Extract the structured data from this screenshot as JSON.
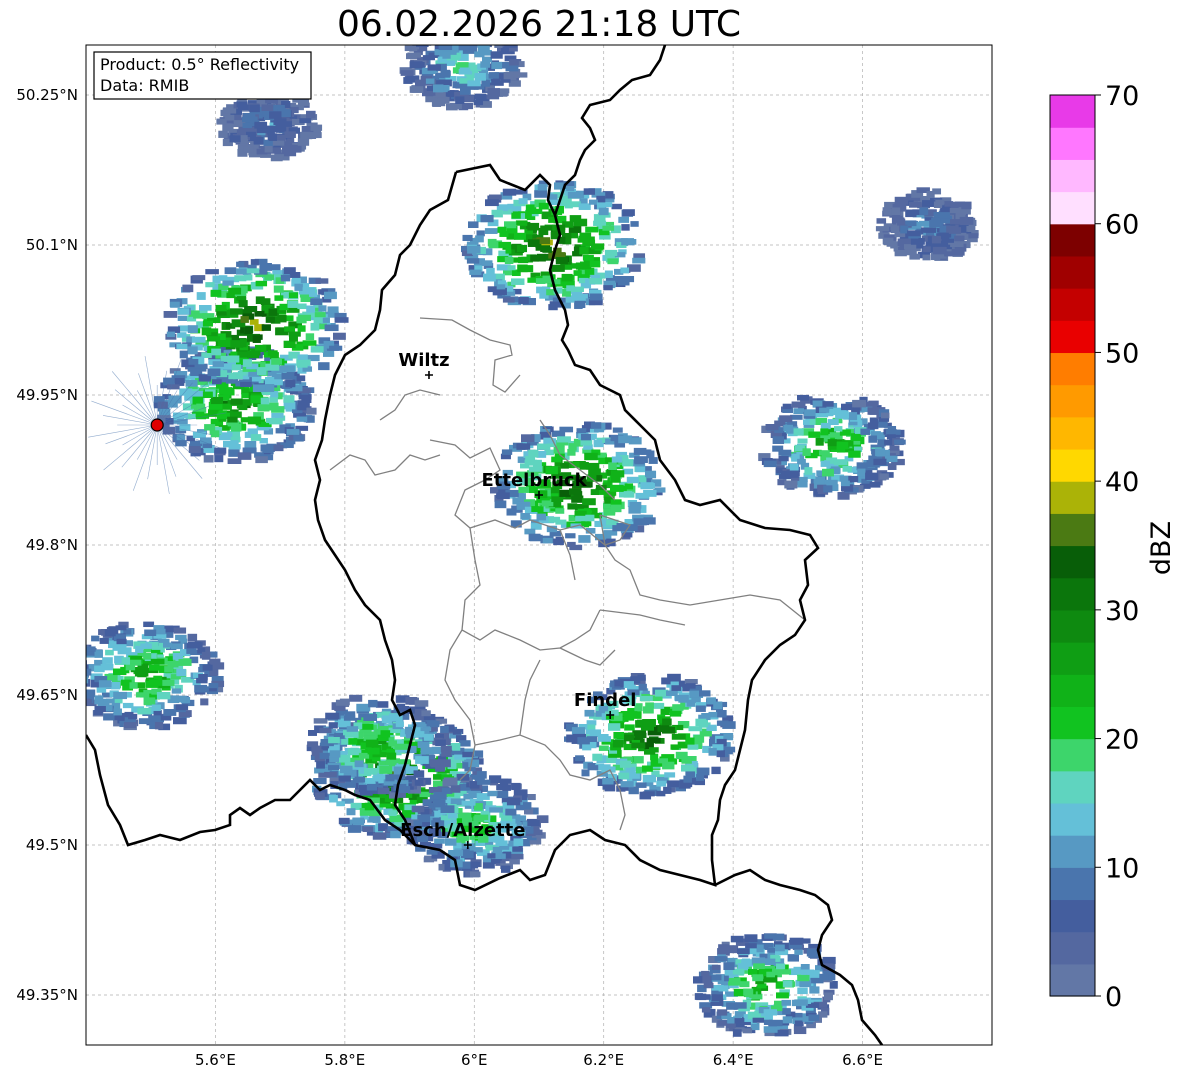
{
  "title": "06.02.2026 21:18 UTC",
  "info_box": {
    "product": "Product: 0.5° Reflectivity",
    "source": "Data: RMIB"
  },
  "axes": {
    "lon_range": [
      5.4,
      6.8
    ],
    "lat_range": [
      49.3,
      50.3
    ],
    "lon_ticks": [
      "5.6°E",
      "5.8°E",
      "6°E",
      "6.2°E",
      "6.4°E",
      "6.6°E"
    ],
    "lat_ticks": [
      "50.25°N",
      "50.1°N",
      "49.95°N",
      "49.8°N",
      "49.65°N",
      "49.5°N",
      "49.35°N"
    ],
    "grid": true
  },
  "cities": [
    {
      "name": "Wiltz",
      "lon": 5.93,
      "lat": 49.97
    },
    {
      "name": "Ettelbruck",
      "lon": 6.1,
      "lat": 49.85
    },
    {
      "name": "Findel",
      "lon": 6.21,
      "lat": 49.63
    },
    {
      "name": "Esch/Alzette",
      "lon": 5.99,
      "lat": 49.5
    }
  ],
  "radar_site": {
    "lon": 5.51,
    "lat": 49.92,
    "color": "#e00000"
  },
  "colorbar": {
    "label": "dBZ",
    "range": [
      0,
      70
    ],
    "tick_labels": [
      "0",
      "10",
      "20",
      "30",
      "40",
      "50",
      "60",
      "70"
    ],
    "colors": [
      "#6277a6",
      "#5468a0",
      "#445e9e",
      "#4a75ad",
      "#5799c3",
      "#64c0d8",
      "#5fd4bf",
      "#3dd56b",
      "#11c320",
      "#10b218",
      "#0f9e14",
      "#0e8a10",
      "#0b760c",
      "#085e08",
      "#4b7a13",
      "#abb307",
      "#ffd800",
      "#ffb700",
      "#ff9a00",
      "#ff7d00",
      "#e90000",
      "#c40000",
      "#a00000",
      "#7d0000",
      "#ffdfff",
      "#ffb8ff",
      "#ff77ff",
      "#e83ae8"
    ]
  },
  "chart_data": {
    "type": "heatmap",
    "title": "06.02.2026 21:18 UTC",
    "value_label": "dBZ",
    "value_range": [
      0,
      70
    ],
    "echo_cells": [
      {
        "lon": 5.49,
        "lat": 49.67,
        "max_dbz": 32
      },
      {
        "lon": 5.63,
        "lat": 49.94,
        "max_dbz": 35
      },
      {
        "lon": 5.66,
        "lat": 50.02,
        "max_dbz": 42
      },
      {
        "lon": 5.88,
        "lat": 49.57,
        "max_dbz": 40
      },
      {
        "lon": 5.85,
        "lat": 49.6,
        "max_dbz": 30
      },
      {
        "lon": 6.0,
        "lat": 49.52,
        "max_dbz": 28
      },
      {
        "lon": 6.16,
        "lat": 49.86,
        "max_dbz": 40
      },
      {
        "lon": 6.27,
        "lat": 49.61,
        "max_dbz": 38
      },
      {
        "lon": 6.55,
        "lat": 49.9,
        "max_dbz": 30
      },
      {
        "lon": 6.45,
        "lat": 49.36,
        "max_dbz": 30
      },
      {
        "lon": 5.98,
        "lat": 50.28,
        "max_dbz": 22
      },
      {
        "lon": 6.12,
        "lat": 50.1,
        "max_dbz": 42
      },
      {
        "lon": 5.68,
        "lat": 50.22,
        "max_dbz": 15
      },
      {
        "lon": 6.7,
        "lat": 50.12,
        "max_dbz": 15
      }
    ]
  }
}
